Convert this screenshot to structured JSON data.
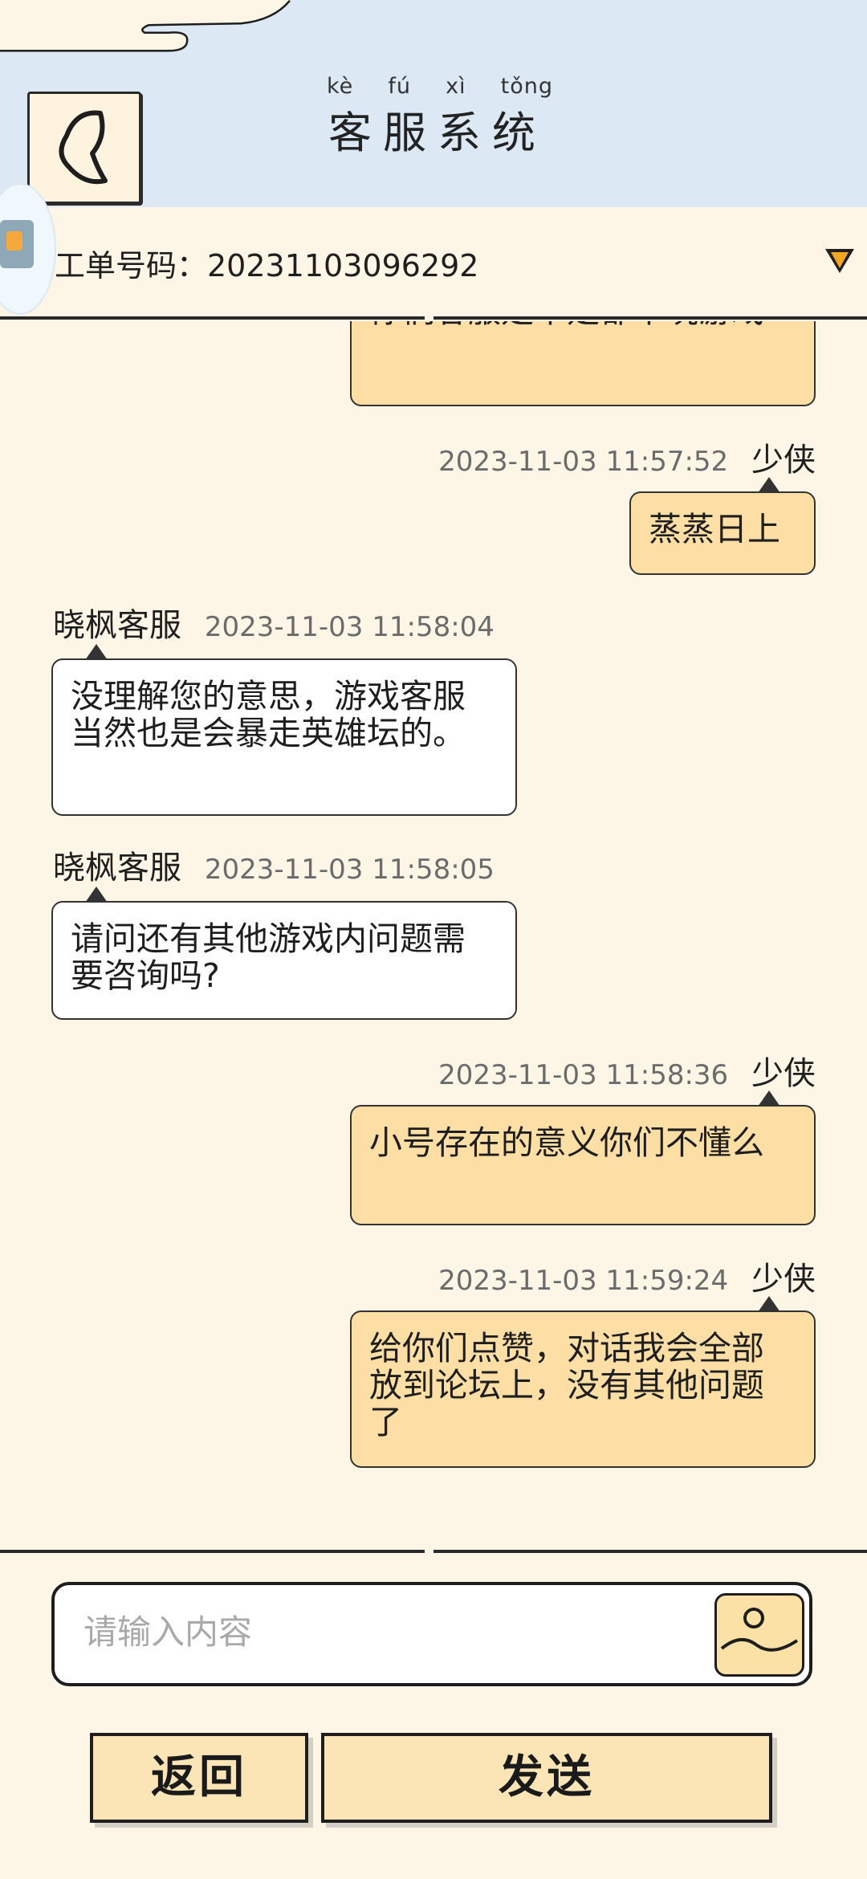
{
  "header": {
    "title": "客服系统",
    "pinyin": [
      "kè",
      "fú",
      "xì",
      "tǒng"
    ]
  },
  "ticket": {
    "label": "工单号码：20231103096292"
  },
  "messages": [
    {
      "side": "user",
      "text": "你们客服是不是都不玩游戏"
    },
    {
      "side": "user",
      "name": "少侠",
      "time": "2023-11-03 11:57:52",
      "text": "蒸蒸日上"
    },
    {
      "side": "agent",
      "name": "晓枫客服",
      "time": "2023-11-03 11:58:04",
      "text": "没理解您的意思，游戏客服当然也是会暴走英雄坛的。"
    },
    {
      "side": "agent",
      "name": "晓枫客服",
      "time": "2023-11-03 11:58:05",
      "text": "请问还有其他游戏内问题需要咨询吗?"
    },
    {
      "side": "user",
      "name": "少侠",
      "time": "2023-11-03 11:58:36",
      "text": "小号存在的意义你们不懂么"
    },
    {
      "side": "user",
      "name": "少侠",
      "time": "2023-11-03 11:59:24",
      "text": "给你们点赞，对话我会全部放到论坛上，没有其他问题了"
    }
  ],
  "input": {
    "placeholder": "请输入内容",
    "value": ""
  },
  "buttons": {
    "back": "返回",
    "send": "发送"
  },
  "icons": {
    "back": "back-arrow-icon",
    "ticket_toggle": "triangle-down-icon",
    "image": "image-icon",
    "floating": "app-float-icon"
  },
  "colors": {
    "header_bg": "#dce9f4",
    "page_bg": "#fdf5e6",
    "user_bubble": "#fddfa6",
    "agent_bubble": "#ffffff",
    "accent": "#f4a623"
  }
}
